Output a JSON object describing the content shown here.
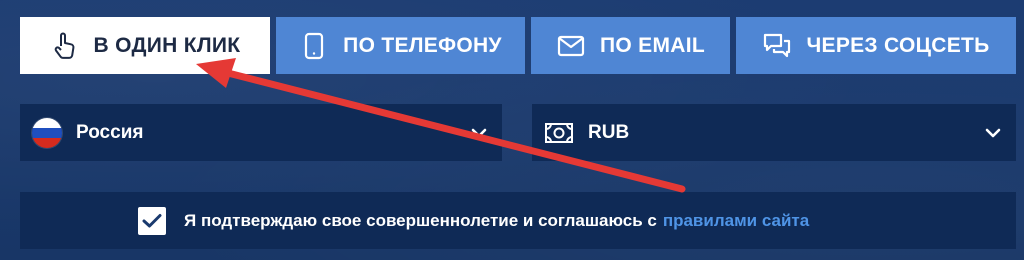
{
  "tabs": [
    {
      "label": "В ОДИН КЛИК",
      "icon": "pointer-hand-icon",
      "active": true
    },
    {
      "label": "ПО ТЕЛЕФОНУ",
      "icon": "phone-icon",
      "active": false
    },
    {
      "label": "ПО EMAIL",
      "icon": "envelope-icon",
      "active": false
    },
    {
      "label": "ЧЕРЕЗ СОЦСЕТЬ",
      "icon": "chat-bubbles-icon",
      "active": false
    }
  ],
  "country_select": {
    "value": "Россия",
    "icon": "russia-flag-icon"
  },
  "currency_select": {
    "value": "RUB",
    "icon": "banknote-icon"
  },
  "agreement": {
    "checked": true,
    "text": "Я подтверждаю свое совершеннолетие и соглашаюсь с",
    "link_text": "правилами сайта"
  },
  "colors": {
    "background": "#1a3a6e",
    "tab_inactive": "#4f86d4",
    "tab_active": "#ffffff",
    "field_bg": "#0f2a56",
    "link": "#4f94e6",
    "arrow": "#e53935"
  }
}
